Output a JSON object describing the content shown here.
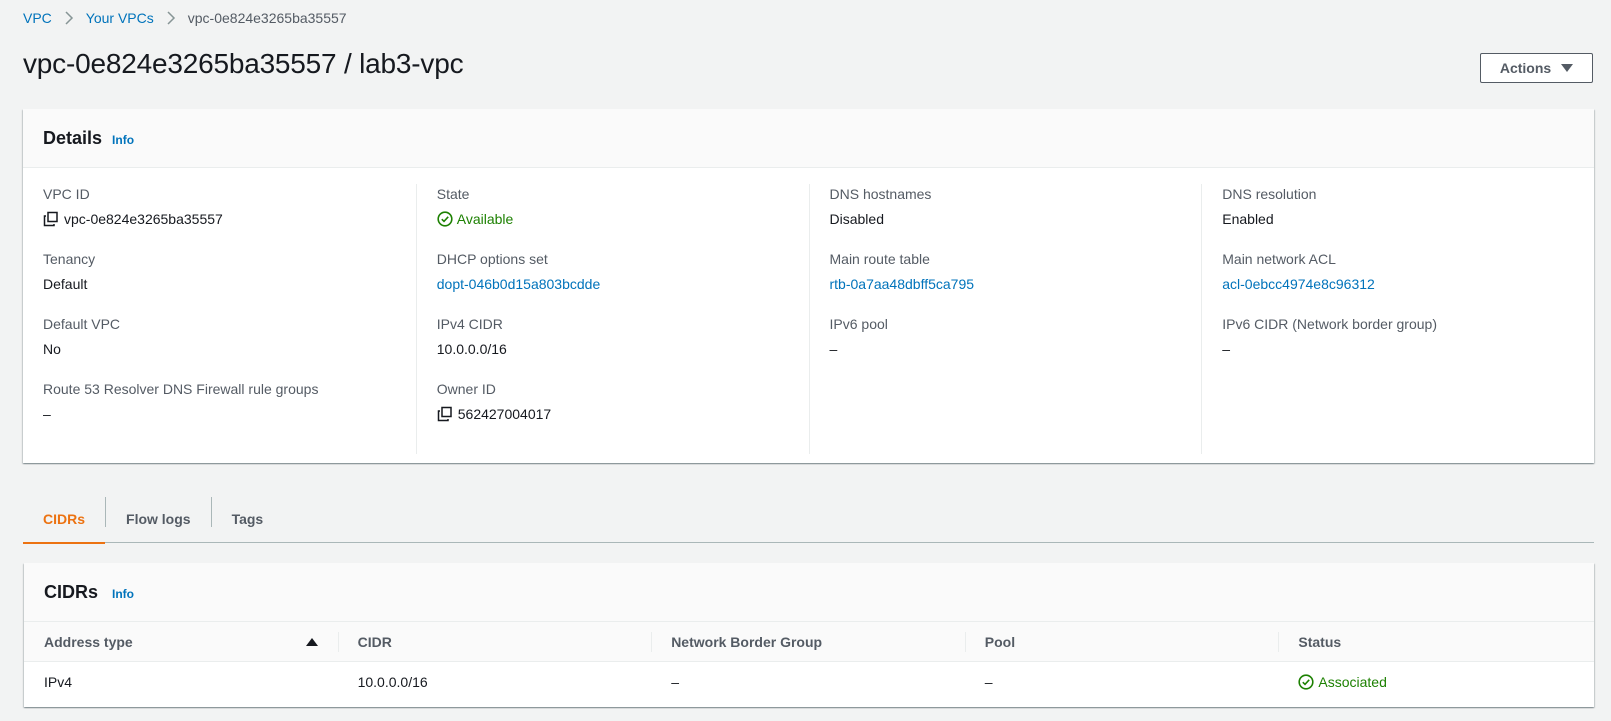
{
  "breadcrumb": {
    "items": [
      "VPC",
      "Your VPCs"
    ],
    "current": "vpc-0e824e3265ba35557"
  },
  "page": {
    "title": "vpc-0e824e3265ba35557 / lab3-vpc",
    "actions_label": "Actions"
  },
  "details": {
    "title": "Details",
    "info_label": "Info",
    "columns": [
      [
        {
          "label": "VPC ID",
          "value": "vpc-0e824e3265ba35557"
        },
        {
          "label": "Tenancy",
          "value": "Default"
        },
        {
          "label": "Default VPC",
          "value": "No"
        },
        {
          "label": "Route 53 Resolver DNS Firewall rule groups",
          "value": "–"
        }
      ],
      [
        {
          "label": "State",
          "value": "Available"
        },
        {
          "label": "DHCP options set",
          "value": "dopt-046b0d15a803bcdde"
        },
        {
          "label": "IPv4 CIDR",
          "value": "10.0.0.0/16"
        },
        {
          "label": "Owner ID",
          "value": "562427004017"
        }
      ],
      [
        {
          "label": "DNS hostnames",
          "value": "Disabled"
        },
        {
          "label": "Main route table",
          "value": "rtb-0a7aa48dbff5ca795"
        },
        {
          "label": "IPv6 pool",
          "value": "–"
        }
      ],
      [
        {
          "label": "DNS resolution",
          "value": "Enabled"
        },
        {
          "label": "Main network ACL",
          "value": "acl-0ebcc4974e8c96312"
        },
        {
          "label": "IPv6 CIDR (Network border group)",
          "value": "–"
        }
      ]
    ]
  },
  "tabs": [
    "CIDRs",
    "Flow logs",
    "Tags"
  ],
  "cidrs": {
    "title": "CIDRs",
    "info_label": "Info",
    "columns": [
      "Address type",
      "CIDR",
      "Network Border Group",
      "Pool",
      "Status"
    ],
    "rows": [
      [
        "IPv4",
        "10.0.0.0/16",
        "–",
        "–",
        "Associated"
      ]
    ]
  },
  "colors": {
    "link": "#0073bb",
    "success": "#1d8102",
    "active_tab": "#ec7211",
    "background": "#f2f3f3"
  },
  "icons": {
    "breadcrumb_separator": "chevron-right-icon",
    "copy": "copy-icon",
    "status_ok": "status-check-icon",
    "sort": "sort-ascending-icon",
    "actions": "caret-down-icon"
  }
}
